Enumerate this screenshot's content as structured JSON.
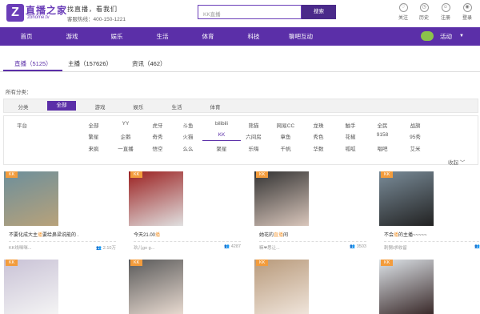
{
  "header": {
    "logo_char": "Z",
    "logo_text": "直播之家",
    "logo_sub": "zbhome.tv",
    "slogan": "找直播，看我们",
    "hotline": "客服热线：400-150-1221",
    "search_placeholder": "KK直播",
    "search_button": "搜索",
    "icons": [
      {
        "name": "follow",
        "label": "关注"
      },
      {
        "name": "history",
        "label": "历史"
      },
      {
        "name": "register",
        "label": "注册"
      },
      {
        "name": "login",
        "label": "登录"
      }
    ]
  },
  "nav": {
    "items": [
      "首页",
      "游戏",
      "娱乐",
      "生活",
      "体育",
      "科技",
      "聊吧互动"
    ],
    "activity": "活动"
  },
  "tabs": [
    {
      "label": "直播（5125）",
      "active": true
    },
    {
      "label": "主播（157626）",
      "active": false
    },
    {
      "label": "资讯（462）",
      "active": false
    }
  ],
  "all_categories_label": "所有分类：",
  "categories": {
    "label": "分类",
    "items": [
      "全部",
      "游戏",
      "娱乐",
      "生活",
      "体育"
    ],
    "active_index": 0
  },
  "platforms": {
    "label": "平台",
    "rows": [
      [
        "全部",
        "YY",
        "虎牙",
        "斗鱼",
        "bilibili",
        "熊猫",
        "网易CC",
        "龙珠",
        "触手",
        "全民",
        "战旗"
      ],
      [
        "繁星",
        "企鹅",
        "奇秀",
        "火猫",
        "KK",
        "六间房",
        "章鱼",
        "秀色",
        "花椒",
        "9158",
        "95秀"
      ],
      [
        "来疯",
        "一直播",
        "悟空",
        "么么",
        "聚星",
        "乐嗨",
        "千帆",
        "华数",
        "呱呱",
        "唱吧",
        "艾米"
      ]
    ],
    "active": "KK",
    "collapse": "收起"
  },
  "cards": [
    {
      "badge": "KK",
      "title_pre": "不要化成大主",
      "title_hl": "播",
      "title_post": "要给鼻梁说能的 .",
      "user": "KK线咪咪...",
      "views": "2.10万"
    },
    {
      "badge": "KK",
      "title_pre": "今天21.00",
      "title_hl": "播",
      "title_post": "",
      "user": "玖儿go g...",
      "views": "4287"
    },
    {
      "badge": "KK",
      "title_pre": "她花的",
      "title_hl": "直播",
      "title_post": "间",
      "user": "嘛❤思让...",
      "views": "3503"
    },
    {
      "badge": "KK",
      "title_pre": "不会",
      "title_hl": "播",
      "title_post": "的主播~~~~~",
      "user": "刺猬i求收留",
      "views": "3378"
    },
    {
      "badge": "KK"
    },
    {
      "badge": "KK"
    },
    {
      "badge": "KK"
    },
    {
      "badge": "KK"
    }
  ],
  "colors": {
    "brand": "#5b2fa8",
    "badge": "#f39c3c"
  }
}
